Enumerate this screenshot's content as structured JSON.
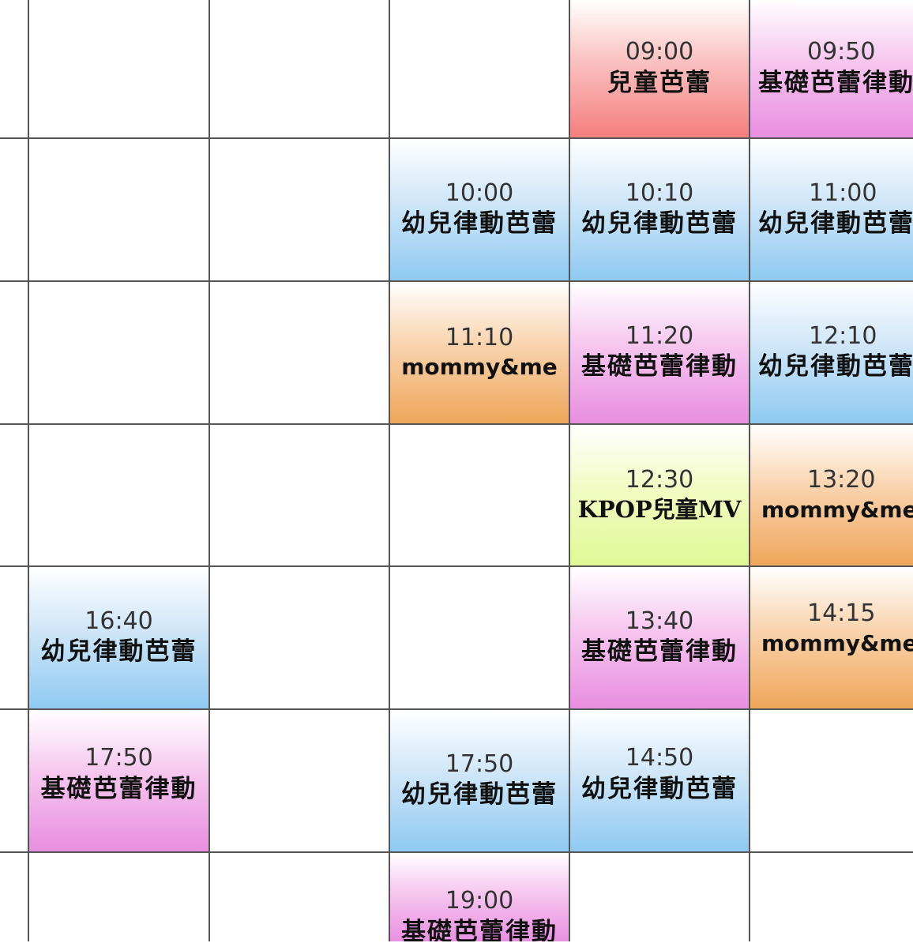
{
  "schedule": {
    "cells": [
      {
        "key": "r0c3",
        "time": "09:00",
        "name": "兒童芭蕾",
        "color": "#f57e7e"
      },
      {
        "key": "r0c4",
        "time": "09:50",
        "name": "基礎芭蕾律動",
        "color": "#e88ee0"
      },
      {
        "key": "r1c2",
        "time": "10:00",
        "name": "幼兒律動芭蕾",
        "color": "#8fcaf2"
      },
      {
        "key": "r1c3",
        "time": "10:10",
        "name": "幼兒律動芭蕾",
        "color": "#8fcaf2"
      },
      {
        "key": "r1c4",
        "time": "11:00",
        "name": "幼兒律動芭蕾",
        "color": "#8fcaf2"
      },
      {
        "key": "r2c2",
        "time": "11:10",
        "name": "mommy&me",
        "color": "#efa65a"
      },
      {
        "key": "r2c3",
        "time": "11:20",
        "name": "基礎芭蕾律動",
        "color": "#e88ee0"
      },
      {
        "key": "r2c4",
        "time": "12:10",
        "name": "幼兒律動芭蕾",
        "color": "#8fcaf2"
      },
      {
        "key": "r3c3",
        "time": "12:30",
        "name": "KPOP兒童MV",
        "color": "#e1f895"
      },
      {
        "key": "r3c4",
        "time": "13:20",
        "name": "mommy&me",
        "color": "#efa65a"
      },
      {
        "key": "r4c0",
        "time": "16:40",
        "name": "幼兒律動芭蕾",
        "color": "#8fcaf2"
      },
      {
        "key": "r4c3",
        "time": "13:40",
        "name": "基礎芭蕾律動",
        "color": "#e88ee0"
      },
      {
        "key": "r4c4",
        "time": "14:15",
        "name": "mommy&me",
        "color": "#efa65a"
      },
      {
        "key": "r5c0",
        "time": "17:50",
        "name": "基礎芭蕾律動",
        "color": "#e88ee0"
      },
      {
        "key": "r5c2",
        "time": "17:50",
        "name": "幼兒律動芭蕾",
        "color": "#8fcaf2"
      },
      {
        "key": "r5c3",
        "time": "14:50",
        "name": "幼兒律動芭蕾",
        "color": "#8fcaf2"
      },
      {
        "key": "r6c2",
        "time": "19:00",
        "name": "基礎芭蕾律動",
        "color": "#e88ee0"
      }
    ]
  }
}
